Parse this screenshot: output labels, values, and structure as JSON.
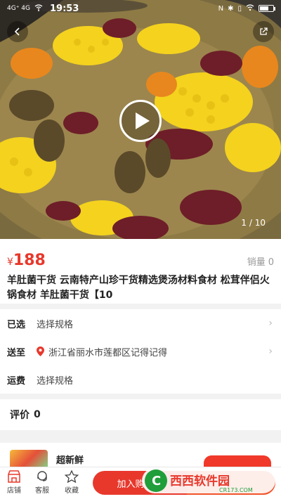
{
  "status_bar": {
    "signal": "4G⁺ 4G",
    "time": "19:53",
    "icons": [
      "nfc-icon",
      "bluetooth-icon",
      "vibrate-icon",
      "wifi-icon"
    ],
    "battery_level": 0.65
  },
  "hero": {
    "counter": "1 / 10"
  },
  "product": {
    "currency": "¥",
    "price": "188",
    "sales_label": "销量",
    "sales_value": "0",
    "title": "羊肚菌干货 云南特产山珍干货精选煲汤材料食材 松茸伴侣火锅食材 羊肚菌干货【10"
  },
  "options": {
    "selected_label": "已选",
    "selected_value": "选择规格",
    "ship_to_label": "送至",
    "ship_to_value": "浙江省丽水市莲都区记得记得",
    "freight_label": "运费",
    "freight_value": "选择规格"
  },
  "reviews": {
    "label": "评价",
    "count": "0"
  },
  "shop": {
    "name": "超新鲜"
  },
  "bottom_bar": {
    "store_label": "店铺",
    "service_label": "客服",
    "favorite_label": "收藏",
    "add_to_cart_label": "加入购物车",
    "accent": "#e8382c"
  },
  "watermark": {
    "text": "西西软件园",
    "url_text": "CR173.COM"
  }
}
